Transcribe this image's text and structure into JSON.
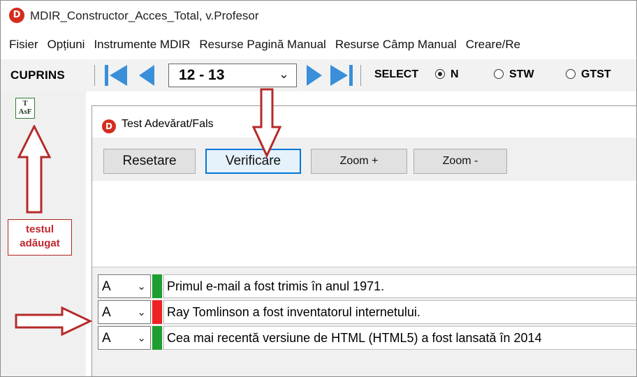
{
  "window": {
    "title": "MDIR_Constructor_Acces_Total, v.Profesor",
    "logo_letter": "D"
  },
  "menu": [
    "Fisier",
    "Opțiuni",
    "Instrumente MDIR",
    "Resurse Pagină Manual",
    "Resurse Câmp Manual",
    "Creare/Re"
  ],
  "toolbar": {
    "cuprins": "CUPRINS",
    "pages_value": "12 - 13",
    "select_label": "SELECT",
    "radios": [
      {
        "label": "N",
        "selected": true
      },
      {
        "label": "STW",
        "selected": false
      },
      {
        "label": "GTST",
        "selected": false
      }
    ],
    "nav_color": "#3a8fd9"
  },
  "sidebar": {
    "test_icon": {
      "top": "T",
      "bottom": "AsF",
      "icon": "test-true-false-icon"
    },
    "annotation_line1": "testul",
    "annotation_line2": "adăugat"
  },
  "test_window": {
    "title": "Test Adevărat/Fals",
    "logo_letter": "D",
    "buttons": {
      "reset": "Resetare",
      "verify": "Verificare",
      "zoom_in": "Zoom +",
      "zoom_out": "Zoom -"
    }
  },
  "questions": [
    {
      "answer": "A",
      "status_color": "#1e9e2f",
      "text": "Primul e-mail a fost trimis în anul 1971."
    },
    {
      "answer": "A",
      "status_color": "#ee2222",
      "text": "Ray Tomlinson a fost inventatorul internetului."
    },
    {
      "answer": "A",
      "status_color": "#1e9e2f",
      "text": "Cea mai recentă versiune de HTML (HTML5) a fost lansată în 2014"
    }
  ],
  "colors": {
    "annotation_red": "#c0272d",
    "focus_blue": "#0078d7"
  }
}
